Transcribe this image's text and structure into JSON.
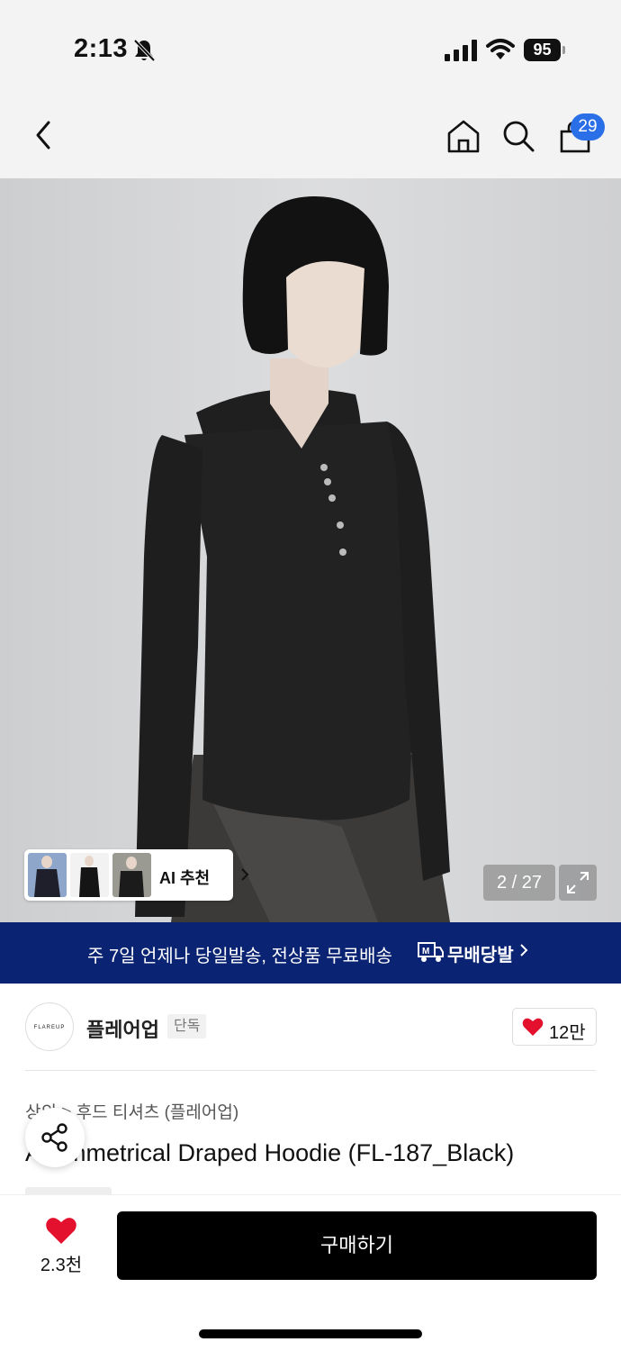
{
  "status_bar": {
    "time": "2:13",
    "battery": "95"
  },
  "nav": {
    "cart_count": "29"
  },
  "hero": {
    "page_counter": "2 / 27",
    "ai_recommend_label": "AI 추천"
  },
  "delivery_banner": {
    "text": "주 7일 언제나 당일발송, 전상품 무료배송",
    "brand": "무배당발"
  },
  "brand": {
    "logo_text": "FLAREUP",
    "name": "플레어업",
    "tag": "단독",
    "like_count": "12만"
  },
  "product": {
    "breadcrumb": "상의 > 후드 티셔츠 (플레어업)",
    "title": "Asymmetrical Draped Hoodie (FL-187_Black)"
  },
  "bottom_bar": {
    "wish_count": "2.3천",
    "buy_label": "구매하기"
  },
  "colors": {
    "banner": "#0a2372",
    "accent": "#2a6fe8",
    "heart": "#e3112d"
  }
}
